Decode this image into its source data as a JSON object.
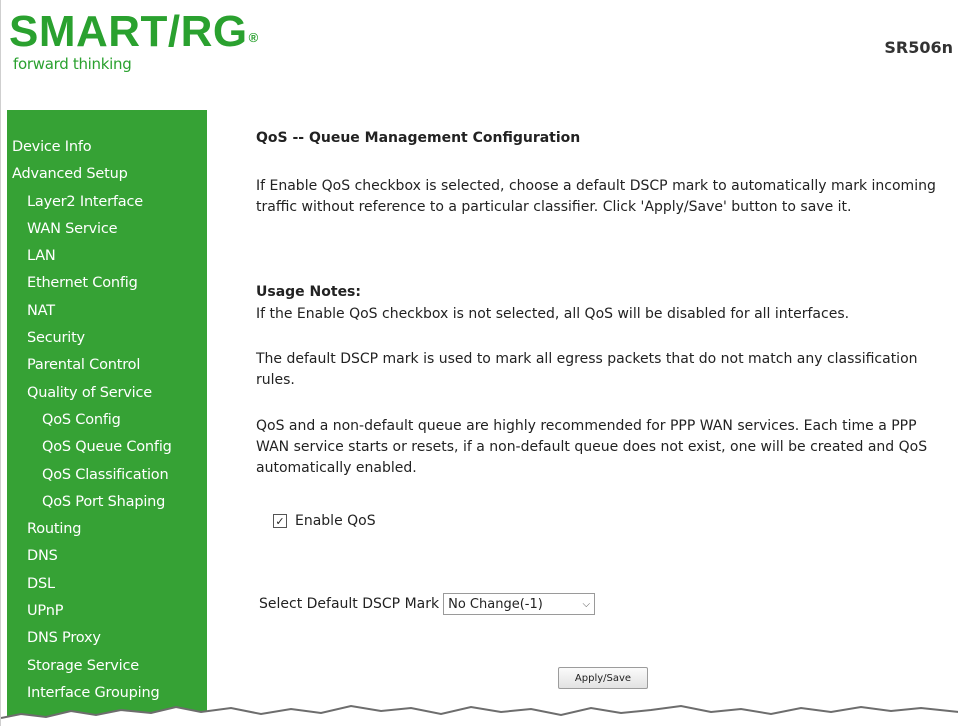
{
  "header": {
    "logo_text": "SMART/RG",
    "logo_mark": "®",
    "tagline": "forward thinking",
    "model": "SR506n"
  },
  "sidebar": {
    "items": [
      {
        "label": "Device Info",
        "level": 0
      },
      {
        "label": "Advanced Setup",
        "level": 0
      },
      {
        "label": "Layer2 Interface",
        "level": 1
      },
      {
        "label": "WAN Service",
        "level": 1
      },
      {
        "label": "LAN",
        "level": 1
      },
      {
        "label": "Ethernet Config",
        "level": 1
      },
      {
        "label": "NAT",
        "level": 1
      },
      {
        "label": "Security",
        "level": 1
      },
      {
        "label": "Parental Control",
        "level": 1
      },
      {
        "label": "Quality of Service",
        "level": 1
      },
      {
        "label": "QoS Config",
        "level": 2
      },
      {
        "label": "QoS Queue Config",
        "level": 2
      },
      {
        "label": "QoS Classification",
        "level": 2
      },
      {
        "label": "QoS Port Shaping",
        "level": 2
      },
      {
        "label": "Routing",
        "level": 1
      },
      {
        "label": "DNS",
        "level": 1
      },
      {
        "label": "DSL",
        "level": 1
      },
      {
        "label": "UPnP",
        "level": 1
      },
      {
        "label": "DNS Proxy",
        "level": 1
      },
      {
        "label": "Storage Service",
        "level": 1
      },
      {
        "label": "Interface Grouping",
        "level": 1
      }
    ]
  },
  "main": {
    "title": "QoS -- Queue Management Configuration",
    "intro": "If Enable QoS checkbox is selected, choose a default DSCP mark to automatically mark incoming traffic without reference to a particular classifier. Click 'Apply/Save' button to save it.",
    "usage_heading": "Usage Notes:",
    "note1": "If the Enable QoS checkbox is not selected, all QoS will be disabled for all interfaces.",
    "note2": "The default DSCP mark is used to mark all egress packets that do not match any classification rules.",
    "note3": "QoS and a non-default queue are highly recommended for PPP WAN services. Each time a PPP WAN service starts or resets, if a non-default queue does not exist, one will be created and QoS automatically enabled.",
    "enable_qos_label": "Enable QoS",
    "enable_qos_checked": true,
    "dscp_label": "Select Default DSCP Mark",
    "dscp_value": "No Change(-1)",
    "apply_label": "Apply/Save"
  },
  "colors": {
    "brand_green": "#2aa12f",
    "sidebar_bg": "#36a235"
  }
}
